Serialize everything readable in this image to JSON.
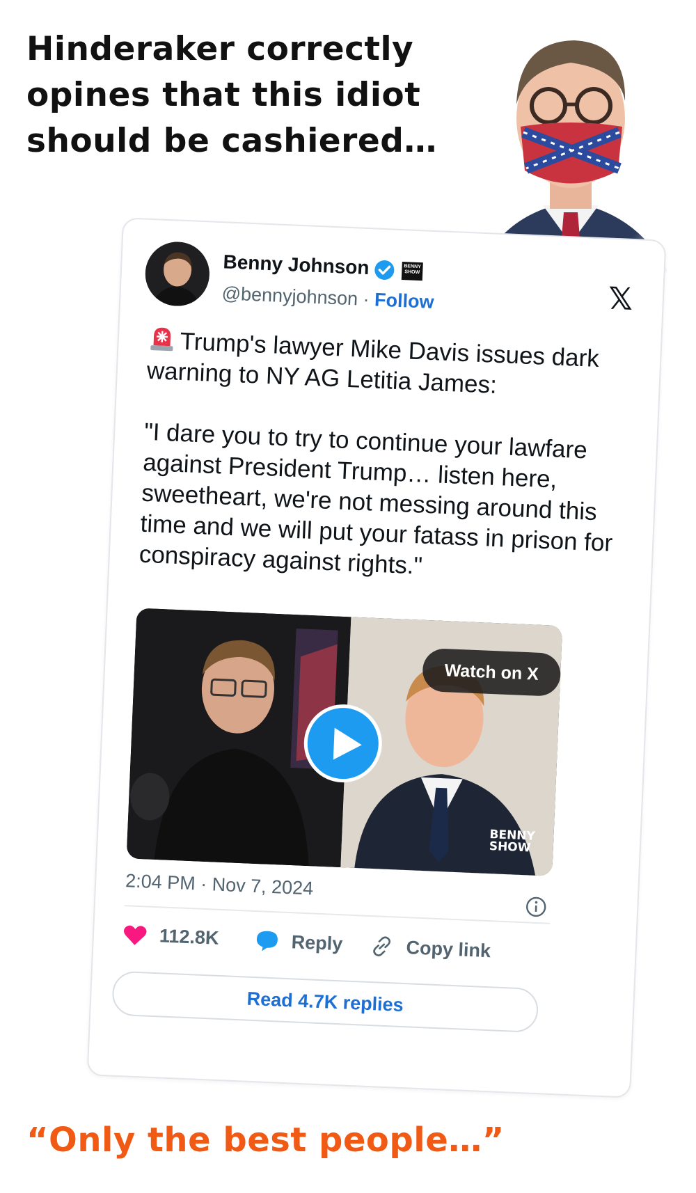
{
  "headline": {
    "lines": [
      "Hinderaker correctly",
      "opines that this idiot",
      "should be cashiered…"
    ]
  },
  "tweet": {
    "author_name": "Benny Johnson",
    "handle": "@bennyjohnson",
    "separator": "·",
    "follow_label": "Follow",
    "paragraphs": [
      "Trump's lawyer Mike Davis issues dark warning to NY AG Letitia James:",
      "\"I dare you to try to continue your lawfare against President Trump… listen here, sweetheart, we're not messing around this time and we will put your fatass in prison for conspiracy against rights.\""
    ],
    "video": {
      "watch_label": "Watch on X",
      "brand_label_1": "BENNY",
      "brand_label_2": "SHOW"
    },
    "timestamp": "2:04 PM · Nov 7, 2024",
    "like_count": "112.8K",
    "reply_label": "Reply",
    "copy_link_label": "Copy link",
    "read_replies_label": "Read 4.7K replies"
  },
  "footer": {
    "quote": "“Only the best people…”"
  },
  "colors": {
    "accent_blue": "#1d9bf0",
    "link_blue": "#1d6fd4",
    "like_pink": "#f91880",
    "footer_orange": "#f05a14"
  },
  "icons": [
    "siren-icon",
    "verified-badge-icon",
    "x-logo-icon",
    "play-icon",
    "info-icon",
    "heart-icon",
    "reply-bubble-icon",
    "link-icon"
  ]
}
